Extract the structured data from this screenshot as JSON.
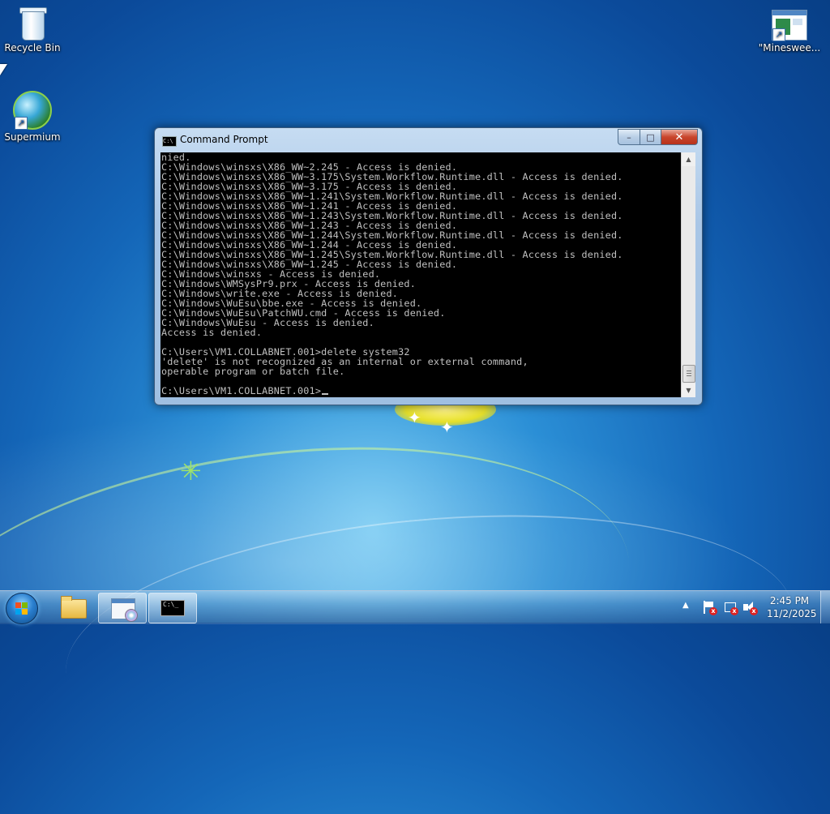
{
  "desktop": {
    "icons": [
      {
        "label": "Recycle Bin",
        "icon": "recycle-bin-icon"
      },
      {
        "label": "Supermium",
        "icon": "supermium-icon"
      },
      {
        "label": "\"Minesweeper\"",
        "label_visible": "\"Minesweе...",
        "icon": "minesweeper-shortcut-icon"
      }
    ]
  },
  "cmd_window": {
    "title": "Command Prompt",
    "controls": {
      "minimize": "–",
      "maximize": "□",
      "close": "✕"
    },
    "lines": [
      "nied.",
      "C:\\Windows\\winsxs\\X86_WW~2.245 - Access is denied.",
      "C:\\Windows\\winsxs\\X86_WW~3.175\\System.Workflow.Runtime.dll - Access is denied.",
      "C:\\Windows\\winsxs\\X86_WW~3.175 - Access is denied.",
      "C:\\Windows\\winsxs\\X86_WW~1.241\\System.Workflow.Runtime.dll - Access is denied.",
      "C:\\Windows\\winsxs\\X86_WW~1.241 - Access is denied.",
      "C:\\Windows\\winsxs\\X86_WW~1.243\\System.Workflow.Runtime.dll - Access is denied.",
      "C:\\Windows\\winsxs\\X86_WW~1.243 - Access is denied.",
      "C:\\Windows\\winsxs\\X86_WW~1.244\\System.Workflow.Runtime.dll - Access is denied.",
      "C:\\Windows\\winsxs\\X86_WW~1.244 - Access is denied.",
      "C:\\Windows\\winsxs\\X86_WW~1.245\\System.Workflow.Runtime.dll - Access is denied.",
      "C:\\Windows\\winsxs\\X86_WW~1.245 - Access is denied.",
      "C:\\Windows\\winsxs - Access is denied.",
      "C:\\Windows\\WMSysPr9.prx - Access is denied.",
      "C:\\Windows\\write.exe - Access is denied.",
      "C:\\Windows\\WuEsu\\bbe.exe - Access is denied.",
      "C:\\Windows\\WuEsu\\PatchWU.cmd - Access is denied.",
      "C:\\Windows\\WuEsu - Access is denied.",
      "Access is denied.",
      "",
      "C:\\Users\\VM1.COLLABNET.001>delete system32",
      "'delete' is not recognized as an internal or external command,",
      "operable program or batch file.",
      "",
      "C:\\Users\\VM1.COLLABNET.001>"
    ]
  },
  "taskbar": {
    "start_label": "Start",
    "items": [
      {
        "name": "windows-explorer",
        "icon": "folder-icon",
        "active": false
      },
      {
        "name": "program-window",
        "icon": "program-icon",
        "active": false
      },
      {
        "name": "command-prompt",
        "icon": "cmd-icon",
        "active": true,
        "glyph": "C:\\_"
      }
    ],
    "tray": {
      "time": "2:45 PM",
      "date": "11/2/2025",
      "overflow_arrow": "▲"
    }
  }
}
